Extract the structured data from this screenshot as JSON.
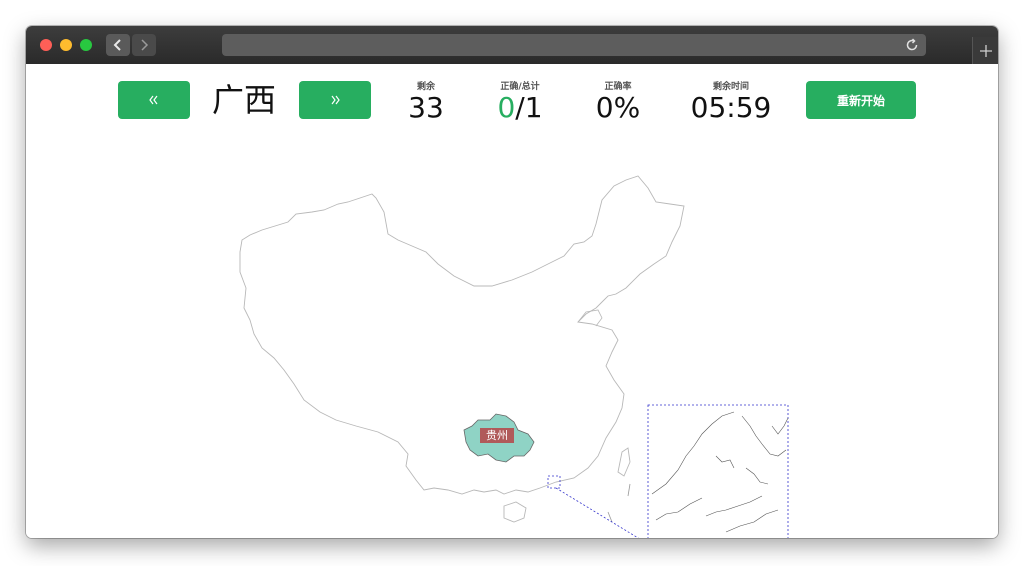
{
  "game": {
    "target_province": "广西",
    "prev_icon": "double-chevron-left-icon",
    "next_icon": "double-chevron-right-icon",
    "restart_label": "重新开始"
  },
  "stats": {
    "remaining_label": "剩余",
    "remaining_value": "33",
    "ratio_label": "正确/总计",
    "correct_value": "0",
    "total_value": "/1",
    "rate_label": "正确率",
    "rate_value": "0%",
    "time_label": "剩余时间",
    "time_value": "05:59"
  },
  "map": {
    "guessed_province_label": "贵州",
    "guessed_color": "#8fd3c5",
    "label_color": "#b05a5a",
    "inset_border_color": "#3333cc"
  },
  "colors": {
    "accent": "#27ae60"
  }
}
